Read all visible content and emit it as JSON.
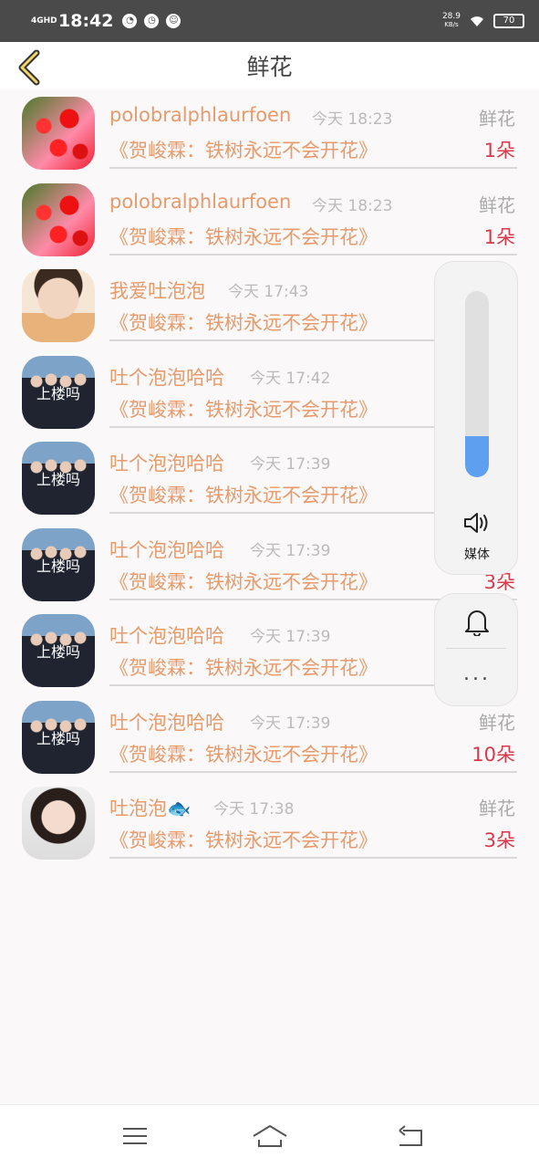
{
  "status_bar": {
    "network": "4GHD",
    "time": "18:42",
    "speed_value": "28.9",
    "speed_unit": "KB/s",
    "battery": "70"
  },
  "header": {
    "title": "鲜花"
  },
  "list": [
    {
      "name": "polobralphlaurfoen",
      "time": "今天 18:23",
      "gift": "鲜花",
      "message": "《贺峻霖：铁树永远不会开花》",
      "count": "1朵",
      "avatar": "flower"
    },
    {
      "name": "polobralphlaurfoen",
      "time": "今天 18:23",
      "gift": "鲜花",
      "message": "《贺峻霖：铁树永远不会开花》",
      "count": "1朵",
      "avatar": "flower"
    },
    {
      "name": "我爱吐泡泡",
      "time": "今天 17:43",
      "gift": "",
      "message": "《贺峻霖：铁树永远不会开花》",
      "count": "",
      "avatar": "boy"
    },
    {
      "name": "吐个泡泡哈哈",
      "time": "今天 17:42",
      "gift": "",
      "message": "《贺峻霖：铁树永远不会开花》",
      "count": "",
      "avatar": "group",
      "avatar_text": "上楼吗"
    },
    {
      "name": "吐个泡泡哈哈",
      "time": "今天 17:39",
      "gift": "",
      "message": "《贺峻霖：铁树永远不会开花》",
      "count": "",
      "avatar": "group",
      "avatar_text": "上楼吗"
    },
    {
      "name": "吐个泡泡哈哈",
      "time": "今天 17:39",
      "gift": "",
      "message": "《贺峻霖：铁树永远不会开花》",
      "count": "3朵",
      "avatar": "group",
      "avatar_text": "上楼吗"
    },
    {
      "name": "吐个泡泡哈哈",
      "time": "今天 17:39",
      "gift": "",
      "message": "《贺峻霖：铁树永远不会开花》",
      "count": "",
      "avatar": "group",
      "avatar_text": "上楼吗"
    },
    {
      "name": "吐个泡泡哈哈",
      "time": "今天 17:39",
      "gift": "鲜花",
      "message": "《贺峻霖：铁树永远不会开花》",
      "count": "10朵",
      "avatar": "group",
      "avatar_text": "上楼吗"
    },
    {
      "name": "吐泡泡🐟",
      "time": "今天 17:38",
      "gift": "鲜花",
      "message": "《贺峻霖：铁树永远不会开花》",
      "count": "3朵",
      "avatar": "girl"
    }
  ],
  "volume_panel": {
    "label": "媒体",
    "level": 0.22,
    "accent": "#5e9fef"
  },
  "more_label": "...",
  "colors": {
    "name": "#e89a6a",
    "count": "#d83a4a",
    "status_bar": "#4a4a4a"
  }
}
